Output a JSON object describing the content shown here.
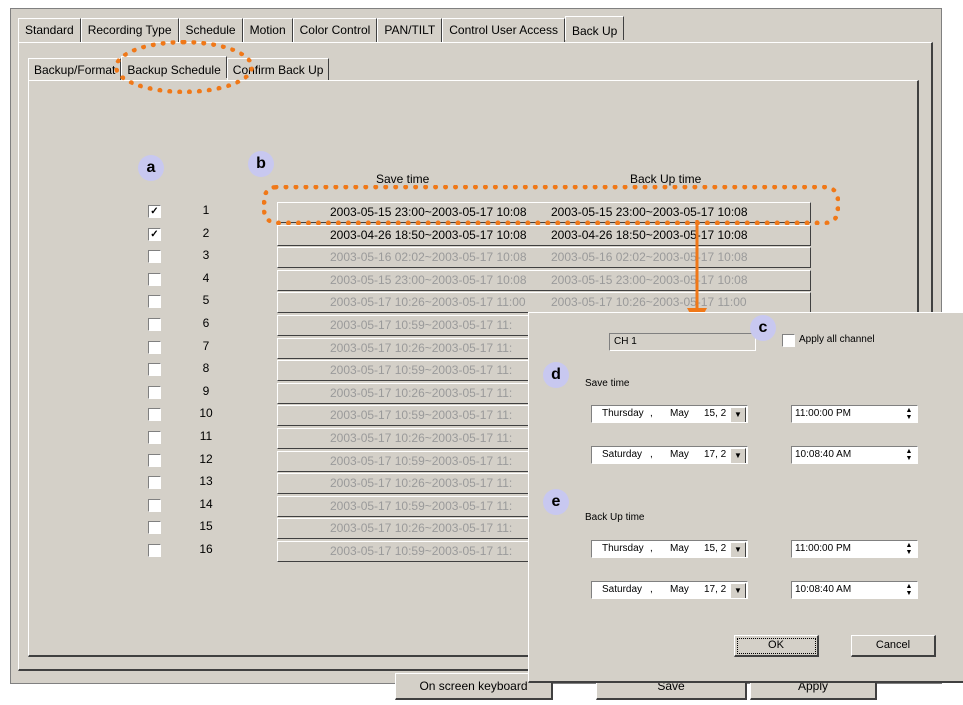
{
  "main_tabs": [
    "Standard",
    "Recording Type",
    "Schedule",
    "Motion",
    "Color Control",
    "PAN/TILT",
    "Control User Access",
    "Back Up"
  ],
  "sub_tabs": [
    "Backup/Format",
    "Backup Schedule",
    "Confirm Back Up"
  ],
  "badges": {
    "a": "a",
    "b": "b",
    "c": "c",
    "d": "d",
    "e": "e"
  },
  "headers": {
    "save_time": "Save time",
    "backup_time": "Back Up time"
  },
  "rows": [
    {
      "num": "1",
      "checked": "✓",
      "save": "2003-05-15 23:00~2003-05-17 10:08",
      "backup": "2003-05-15 23:00~2003-05-17 10:08"
    },
    {
      "num": "2",
      "checked": "✓",
      "save": "2003-04-26 18:50~2003-05-17 10:08",
      "backup": "2003-04-26 18:50~2003-05-17 10:08"
    },
    {
      "num": "3",
      "checked": "",
      "save": "2003-05-16 02:02~2003-05-17 10:08",
      "backup": "2003-05-16 02:02~2003-05-17 10:08"
    },
    {
      "num": "4",
      "checked": "",
      "save": "2003-05-15 23:00~2003-05-17 10:08",
      "backup": "2003-05-15 23:00~2003-05-17 10:08"
    },
    {
      "num": "5",
      "checked": "",
      "save": "2003-05-17 10:26~2003-05-17 11:00",
      "backup": "2003-05-17 10:26~2003-05-17 11:00"
    },
    {
      "num": "6",
      "checked": "",
      "save": "2003-05-17 10:59~2003-05-17 11:",
      "backup": ""
    },
    {
      "num": "7",
      "checked": "",
      "save": "2003-05-17 10:26~2003-05-17 11:",
      "backup": ""
    },
    {
      "num": "8",
      "checked": "",
      "save": "2003-05-17 10:59~2003-05-17 11:",
      "backup": ""
    },
    {
      "num": "9",
      "checked": "",
      "save": "2003-05-17 10:26~2003-05-17 11:",
      "backup": ""
    },
    {
      "num": "10",
      "checked": "",
      "save": "2003-05-17 10:59~2003-05-17 11:",
      "backup": ""
    },
    {
      "num": "11",
      "checked": "",
      "save": "2003-05-17 10:26~2003-05-17 11:",
      "backup": ""
    },
    {
      "num": "12",
      "checked": "",
      "save": "2003-05-17 10:59~2003-05-17 11:",
      "backup": ""
    },
    {
      "num": "13",
      "checked": "",
      "save": "2003-05-17 10:26~2003-05-17 11:",
      "backup": ""
    },
    {
      "num": "14",
      "checked": "",
      "save": "2003-05-17 10:59~2003-05-17 11:",
      "backup": ""
    },
    {
      "num": "15",
      "checked": "",
      "save": "2003-05-17 10:26~2003-05-17 11:",
      "backup": ""
    },
    {
      "num": "16",
      "checked": "",
      "save": "2003-05-17 10:59~2003-05-17 11:",
      "backup": ""
    }
  ],
  "dialog": {
    "channel": "CH 1",
    "apply_all": "Apply all channel",
    "save_time_label": "Save time",
    "backup_time_label": "Back Up time",
    "save_start_day": "Thursday",
    "save_start_sep": ",",
    "save_start_month": "May",
    "save_start_date": "15, 2",
    "save_start_time": "11:00:00 PM",
    "save_end_day": "Saturday",
    "save_end_sep": ",",
    "save_end_month": "May",
    "save_end_date": "17, 2",
    "save_end_time": "10:08:40 AM",
    "bk_start_day": "Thursday",
    "bk_start_sep": ",",
    "bk_start_month": "May",
    "bk_start_date": "15, 2",
    "bk_start_time": "11:00:00 PM",
    "bk_end_day": "Saturday",
    "bk_end_sep": ",",
    "bk_end_month": "May",
    "bk_end_date": "17, 2",
    "bk_end_time": "10:08:40 AM",
    "ok": "OK",
    "cancel": "Cancel"
  },
  "bottom_buttons": {
    "keyboard": "On screen keyboard",
    "save": "Save",
    "apply": "Apply"
  },
  "colors": {
    "highlight": "#f07818",
    "badge": "#c8c8f0",
    "panel": "#d4d0c8"
  }
}
